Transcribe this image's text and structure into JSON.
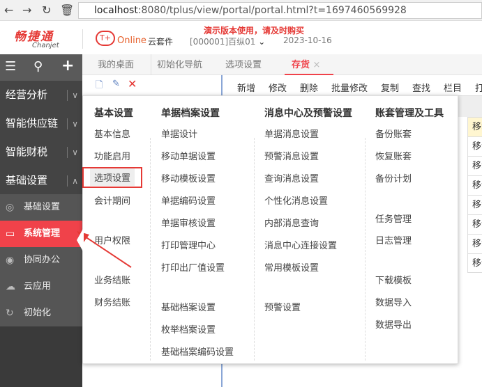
{
  "browser": {
    "url_host": "localhost",
    "url_rest": ":8080/tplus/view/portal/portal.html?t=1697460569928"
  },
  "header": {
    "brand_cn": "畅捷通",
    "brand_en": "Chanjet",
    "product": "Online",
    "product_suffix": "云套件",
    "notice": "演示版本使用，请及时购买",
    "account": "[000001]百纵01",
    "date": "2023-10-16"
  },
  "sidebar": {
    "groups": [
      {
        "label": "经营分析",
        "state": "collapsed"
      },
      {
        "label": "智能供应链",
        "state": "collapsed"
      },
      {
        "label": "智能财税",
        "state": "collapsed"
      },
      {
        "label": "基础设置",
        "state": "expanded"
      }
    ],
    "subitems": [
      {
        "label": "基础设置",
        "icon": "camera-icon"
      },
      {
        "label": "系统管理",
        "icon": "monitor-code-icon",
        "active": true
      },
      {
        "label": "协同办公",
        "icon": "signal-icon"
      },
      {
        "label": "云应用",
        "icon": "cloud-icon"
      },
      {
        "label": "初始化",
        "icon": "refresh-icon"
      }
    ]
  },
  "tabs": [
    {
      "label": "我的桌面"
    },
    {
      "label": "初始化导航"
    },
    {
      "label": "选项设置"
    },
    {
      "label": "存货",
      "active": true
    }
  ],
  "toolbar": [
    "新增",
    "修改",
    "删除",
    "批量修改",
    "复制",
    "查找",
    "栏目",
    "打"
  ],
  "table": {
    "rows": [
      "移动",
      "移动",
      "移动",
      "移动",
      "移动",
      "移动",
      "移动",
      "移动"
    ]
  },
  "menu": {
    "columns": [
      {
        "title": "基本设置",
        "items": [
          "基本信息",
          "功能启用",
          "选项设置",
          "会计期间",
          "用户权限",
          "业务结账",
          "财务结账"
        ]
      },
      {
        "title": "单据档案设置",
        "items": [
          "单据设计",
          "移动单据设置",
          "移动模板设置",
          "单据编码设置",
          "单据审核设置",
          "打印管理中心",
          "打印出厂值设置",
          "基础档案设置",
          "枚举档案设置",
          "基础档案编码设置"
        ]
      },
      {
        "title": "消息中心及预警设置",
        "items": [
          "单据消息设置",
          "预警消息设置",
          "查询消息设置",
          "个性化消息设置",
          "内部消息查询",
          "消息中心连接设置",
          "常用模板设置",
          "预警设置"
        ]
      },
      {
        "title": "账套管理及工具",
        "items": [
          "备份账套",
          "恢复账套",
          "备份计划",
          "任务管理",
          "日志管理",
          "下载模板",
          "数据导入",
          "数据导出"
        ]
      }
    ]
  },
  "colors": {
    "accent": "#f0424a",
    "sidebar": "#444444"
  }
}
